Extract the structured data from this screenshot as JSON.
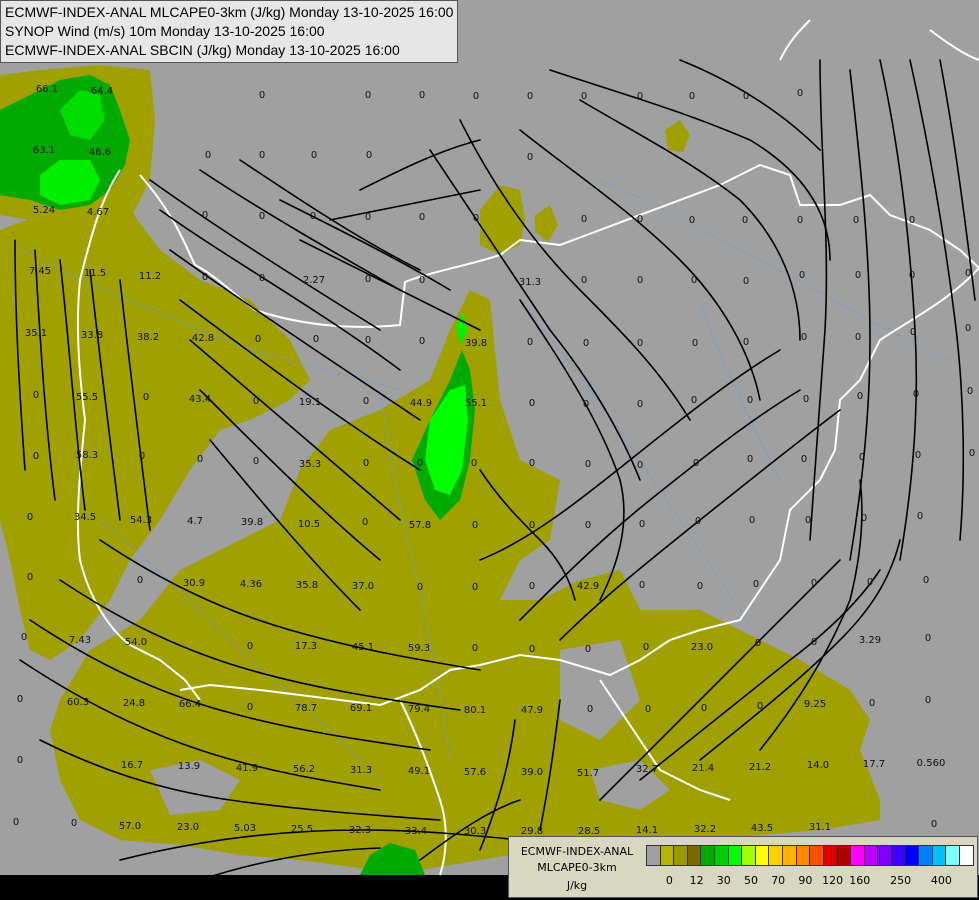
{
  "title_lines": [
    "ECMWF-INDEX-ANAL MLCAPE0-3km (J/kg) Monday 13-10-2025 16:00",
    "SYNOP Wind (m/s) 10m Monday 13-10-2025 16:00",
    "ECMWF-INDEX-ANAL SBCIN (J/kg) Monday 13-10-2025 16:00"
  ],
  "legend": {
    "source": "ECMWF-INDEX-ANAL",
    "parameter": "MLCAPE0-3km",
    "unit": "J/kg",
    "colors": [
      "#a0a0a0",
      "#b4b400",
      "#9a9a00",
      "#7a6a00",
      "#00aa00",
      "#00d000",
      "#00ff00",
      "#a0ff00",
      "#ffff00",
      "#ffd000",
      "#ffb000",
      "#ff8800",
      "#ff5000",
      "#e00000",
      "#b00000",
      "#ff00ff",
      "#c000ff",
      "#8000ff",
      "#4000ff",
      "#0000ff",
      "#0080ff",
      "#00c0ff",
      "#80ffff",
      "#ffffff"
    ],
    "tick_labels": [
      "0",
      "12",
      "30",
      "50",
      "70",
      "90",
      "120",
      "160",
      "250",
      "400"
    ]
  },
  "values": [
    "66.1",
    "64.4",
    "63.1",
    "46.6",
    "5.24",
    "4.67",
    "7.45",
    "11.5",
    "11.2",
    "2.27",
    "31.3",
    "35.1",
    "33.8",
    "38.2",
    "42.8",
    "39.8",
    "43.4",
    "19.1",
    "44.9",
    "55.1",
    "55.5",
    "58.3",
    "35.3",
    "34.5",
    "54.3",
    "4.7",
    "39.8",
    "10.5",
    "57.8",
    "30.9",
    "4.36",
    "35.8",
    "37.0",
    "42.9",
    "7.43",
    "54.0",
    "17.3",
    "45.1",
    "59.3",
    "23.0",
    "3.29",
    "60.3",
    "24.8",
    "66.4",
    "78.7",
    "69.1",
    "79.4",
    "80.1",
    "47.9",
    "9.25",
    "16.7",
    "13.9",
    "41.9",
    "56.2",
    "31.3",
    "49.1",
    "57.6",
    "39.0",
    "51.7",
    "32.7",
    "21.4",
    "21.2",
    "14.0",
    "17.7",
    "0.560",
    "57.0",
    "23.0",
    "5.03",
    "25.5",
    "32.3",
    "33.4",
    "30.3",
    "29.8",
    "28.5",
    "14.1",
    "32.2",
    "43.5",
    "31.1",
    "0"
  ]
}
